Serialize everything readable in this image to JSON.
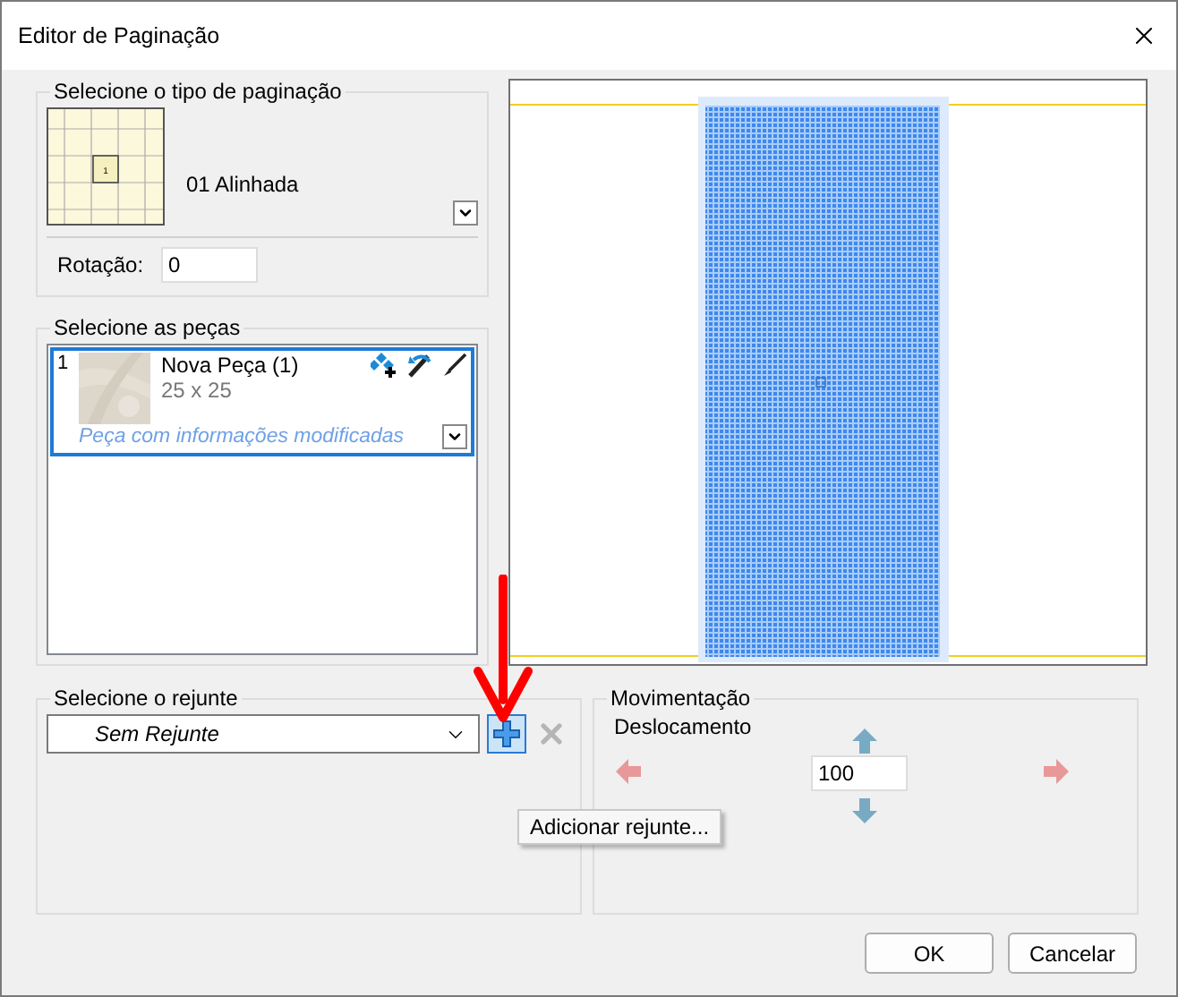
{
  "window": {
    "title": "Editor de Paginação"
  },
  "pagination_type": {
    "legend": "Selecione o tipo de paginação",
    "thumbnail_label": "1",
    "name": "01 Alinhada",
    "rotation_label": "Rotação:",
    "rotation_value": "0"
  },
  "pieces": {
    "legend": "Selecione as peças",
    "items": [
      {
        "index": "1",
        "name": "Nova Peça (1)",
        "size": "25 x 25",
        "note": "Peça com informações modificadas",
        "selected": true
      }
    ]
  },
  "grout": {
    "legend": "Selecione o rejunte",
    "value": "Sem Rejunte",
    "add_tooltip": "Adicionar rejunte...",
    "remove_disabled": true
  },
  "movement": {
    "legend": "Movimentação",
    "label": "Deslocamento",
    "value": "100"
  },
  "buttons": [
    "OK",
    "Cancelar"
  ]
}
